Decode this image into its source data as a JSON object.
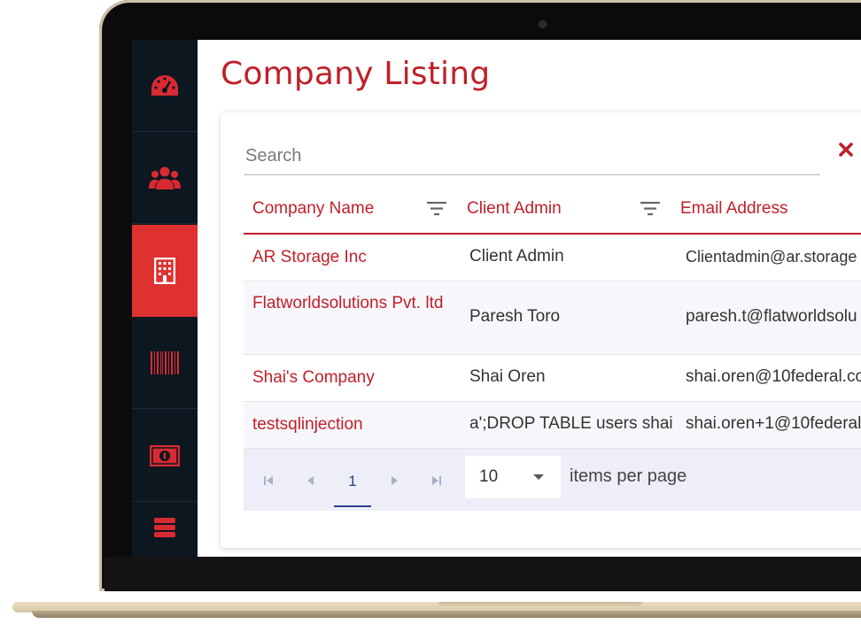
{
  "page": {
    "title": "Company Listing"
  },
  "sidebar": {
    "items": [
      {
        "icon": "dashboard-gauge-icon",
        "active": false
      },
      {
        "icon": "users-group-icon",
        "active": false
      },
      {
        "icon": "building-icon",
        "active": true
      },
      {
        "icon": "barcode-icon",
        "active": false
      },
      {
        "icon": "money-bill-icon",
        "active": false
      },
      {
        "icon": "database-icon",
        "active": false
      }
    ]
  },
  "search": {
    "placeholder": "Search",
    "value": ""
  },
  "table": {
    "headers": {
      "company": "Company Name",
      "admin": "Client Admin",
      "email": "Email Address"
    },
    "rows": [
      {
        "company": "AR Storage Inc",
        "admin": "Client Admin",
        "email": "Clientadmin@ar.storage"
      },
      {
        "company": "Flatworldsolutions Pvt. ltd",
        "admin": "Paresh Toro",
        "email": "paresh.t@flatworldsolu"
      },
      {
        "company": "Shai's Company",
        "admin": "Shai Oren",
        "email": "shai.oren@10federal.co"
      },
      {
        "company": "testsqlinjection",
        "admin": "a';DROP TABLE users shai",
        "email": "shai.oren+1@10federal.c"
      }
    ]
  },
  "pagination": {
    "current_page": "1",
    "page_size": "10",
    "page_size_label": "items per page"
  },
  "colors": {
    "accent": "#c0202a",
    "sidebar_bg": "#0d1720",
    "sidebar_active": "#e03131",
    "pager_bg": "#eeeef8",
    "pager_active": "#2c3e91"
  }
}
